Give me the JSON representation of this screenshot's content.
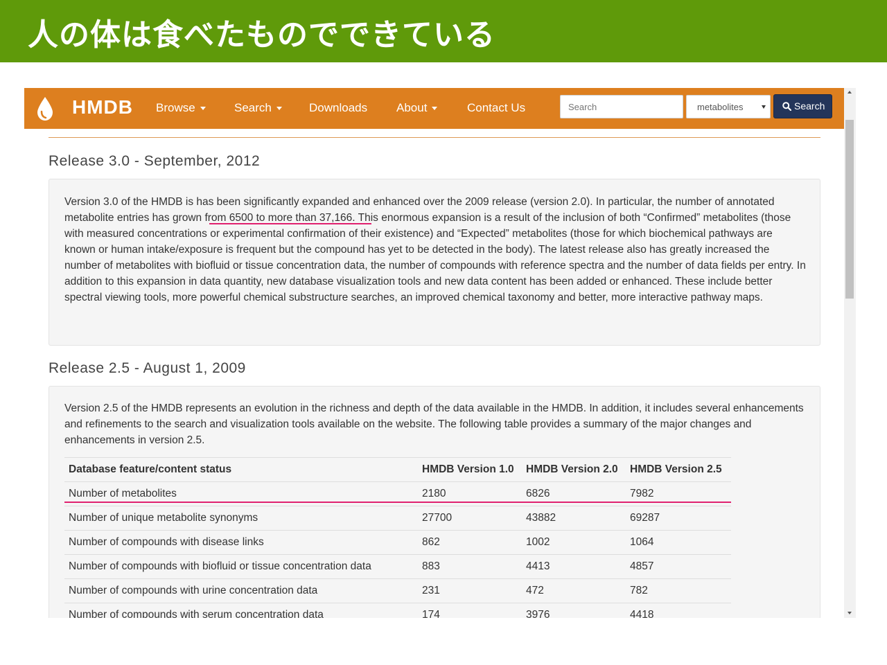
{
  "slide": {
    "title": "人の体は食べたものでできている"
  },
  "colors": {
    "slide_header": "#5f9a0a",
    "navbar": "#dd7f1f",
    "search_button": "#24355a",
    "annotation": "#e0206f"
  },
  "navbar": {
    "brand": "HMDB",
    "logo_icon": "droplet-icon",
    "items": [
      {
        "label": "Browse",
        "dropdown": true
      },
      {
        "label": "Search",
        "dropdown": true
      },
      {
        "label": "Downloads",
        "dropdown": false
      },
      {
        "label": "About",
        "dropdown": true
      },
      {
        "label": "Contact Us",
        "dropdown": false
      }
    ],
    "search_placeholder": "Search",
    "select_value": "metabolites",
    "search_button": "Search"
  },
  "releases": [
    {
      "heading": "Release 3.0 - September, 2012",
      "text_before": "Version 3.0 of the HMDB is has been significantly expanded and enhanced over the 2009 release (version 2.0). In particular, the number of annotated metabolite entries has grown ",
      "text_highlight": "from 6500 to more than 37,166.",
      "text_after": " This enormous expansion is a result of the inclusion of both “Confirmed” metabolites (those with measured concentrations or experimental confirmation of their existence) and “Expected” metabolites (those for which biochemical pathways are known or human intake/exposure is frequent but the compound has yet to be detected in the body). The latest release also has greatly increased the number of metabolites with biofluid or tissue concentration data, the number of compounds with reference spectra and the number of data fields per entry. In addition to this expansion in data quantity, new database visualization tools and new data content has been added or enhanced. These include better spectral viewing tools, more powerful chemical substructure searches, an improved chemical taxonomy and better, more interactive pathway maps."
    },
    {
      "heading": "Release 2.5 - August 1, 2009",
      "text": "Version 2.5 of the HMDB represents an evolution in the richness and depth of the data available in the HMDB. In addition, it includes several enhancements and refinements to the search and visualization tools available on the website. The following table provides a summary of the major changes and enhancements in version 2.5."
    }
  ],
  "table": {
    "headers": [
      "Database feature/content status",
      "HMDB Version 1.0",
      "HMDB Version 2.0",
      "HMDB Version 2.5"
    ],
    "rows": [
      [
        "Number of metabolites",
        "2180",
        "6826",
        "7982"
      ],
      [
        "Number of unique metabolite synonyms",
        "27700",
        "43882",
        "69287"
      ],
      [
        "Number of compounds with disease links",
        "862",
        "1002",
        "1064"
      ],
      [
        "Number of compounds with biofluid or tissue concentration data",
        "883",
        "4413",
        "4857"
      ],
      [
        "Number of compounds with urine concentration data",
        "231",
        "472",
        "782"
      ],
      [
        "Number of compounds with serum concentration data",
        "174",
        "3976",
        "4418"
      ]
    ]
  }
}
